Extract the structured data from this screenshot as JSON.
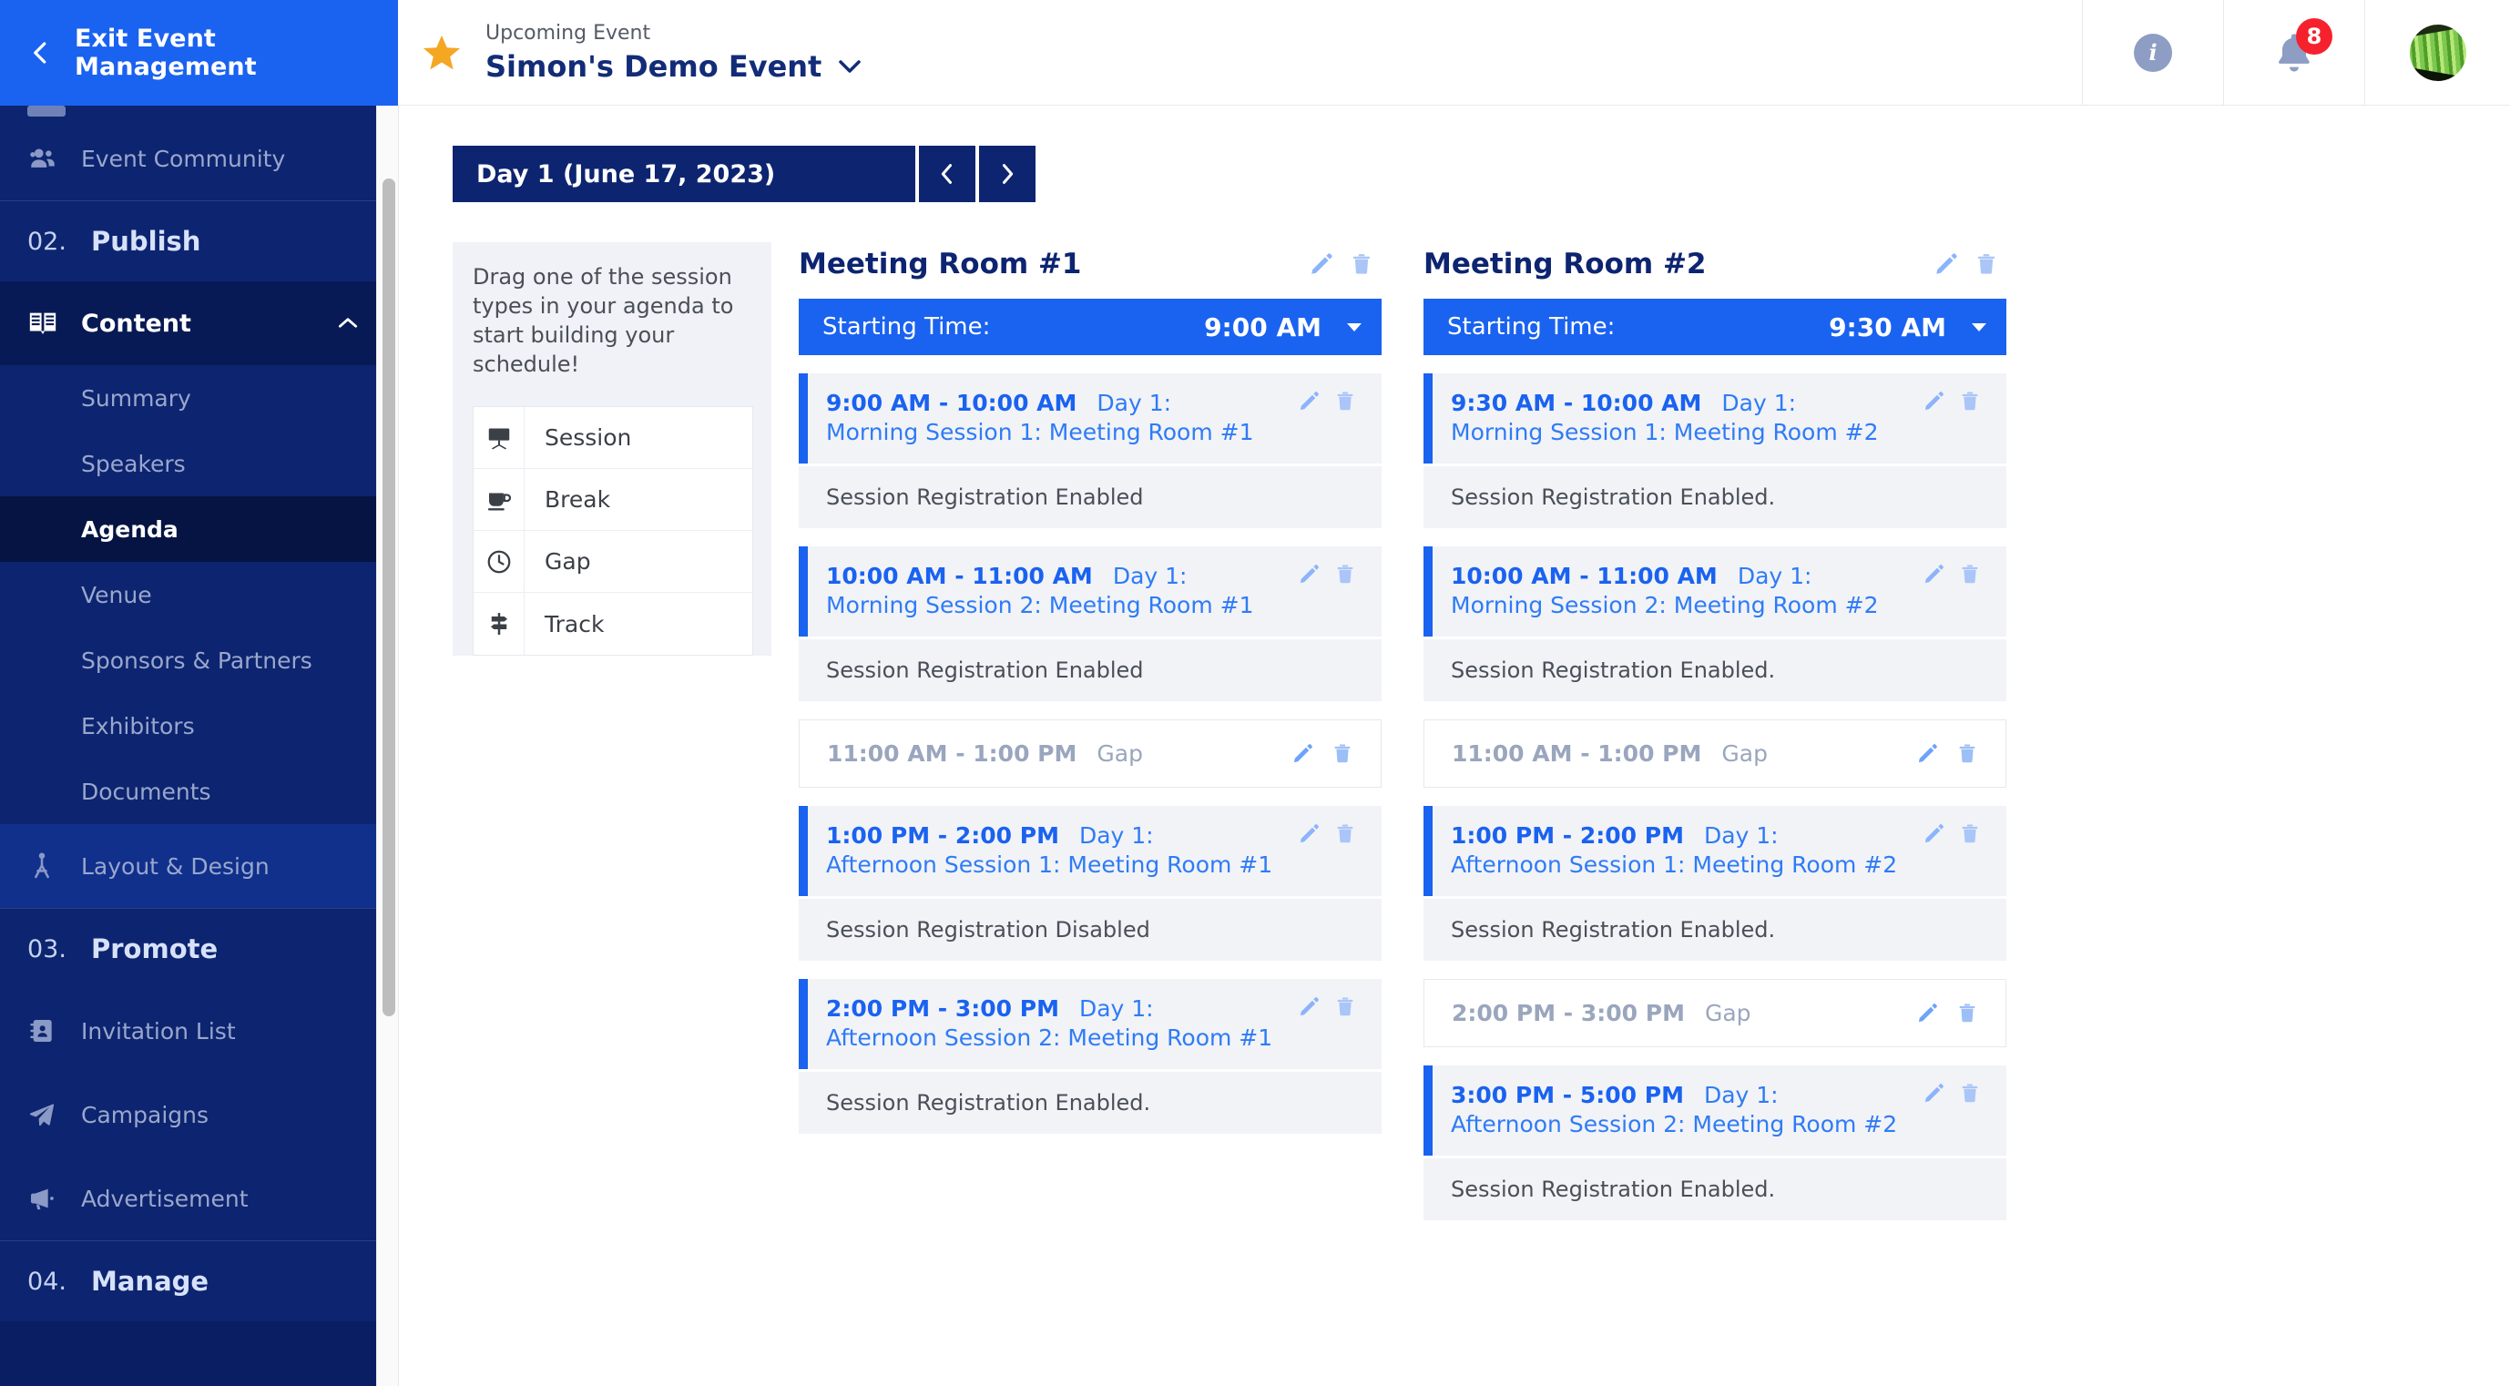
{
  "sidebar": {
    "exit_label": "Exit Event Management",
    "back_icon": "chevron-left-icon",
    "items": [
      {
        "label": "Event Community",
        "icon": "people-icon",
        "type": "item"
      }
    ],
    "groups": [
      {
        "number": "02.",
        "name": "Publish"
      },
      {
        "number": "03.",
        "name": "Promote"
      },
      {
        "number": "04.",
        "name": "Manage"
      }
    ],
    "content_section": {
      "label": "Content",
      "icon": "book-icon",
      "caret": "caret-up-icon",
      "children": [
        {
          "label": "Summary",
          "active": false
        },
        {
          "label": "Speakers",
          "active": false
        },
        {
          "label": "Agenda",
          "active": true
        },
        {
          "label": "Venue",
          "active": false
        },
        {
          "label": "Sponsors & Partners",
          "active": false
        },
        {
          "label": "Exhibitors",
          "active": false
        },
        {
          "label": "Documents",
          "active": false
        }
      ]
    },
    "layout_design": {
      "label": "Layout & Design",
      "icon": "design-icon"
    },
    "promote_items": [
      {
        "label": "Invitation List",
        "icon": "contact-book-icon"
      },
      {
        "label": "Campaigns",
        "icon": "paper-plane-icon"
      },
      {
        "label": "Advertisement",
        "icon": "megaphone-icon"
      }
    ]
  },
  "topbar": {
    "star_icon": "star-icon",
    "upcoming_label": "Upcoming Event",
    "event_name": "Simon's Demo Event",
    "event_caret_icon": "chevron-down-icon",
    "info_icon": "info-icon",
    "info_glyph": "i",
    "bell_icon": "bell-icon",
    "notification_count": "8",
    "avatar_icon": "user-avatar"
  },
  "daybar": {
    "day_label": "Day 1 (June 17, 2023)",
    "prev_icon": "chevron-left-icon",
    "next_icon": "chevron-right-icon"
  },
  "drag_panel": {
    "instruction": "Drag one of the session types in your agenda to start building your schedule!",
    "types": [
      {
        "label": "Session",
        "icon": "presentation-screen-icon"
      },
      {
        "label": "Break",
        "icon": "coffee-cup-icon"
      },
      {
        "label": "Gap",
        "icon": "clock-icon"
      },
      {
        "label": "Track",
        "icon": "signpost-icon"
      }
    ]
  },
  "colors": {
    "brand_blue": "#1a62f0",
    "navy": "#0d2470",
    "link_blue": "#2f7bf6",
    "muted": "#9aa6bd",
    "badge_red": "#f5222d",
    "star_gold": "#f5a623"
  },
  "rooms": [
    {
      "title": "Meeting Room #1",
      "edit_icon": "pencil-icon",
      "delete_icon": "trash-icon",
      "start_label": "Starting Time:",
      "start_value": "9:00 AM",
      "start_caret_icon": "caret-down-icon",
      "entries": [
        {
          "kind": "session",
          "time": "9:00 AM - 10:00 AM",
          "day": "Day 1:",
          "name": "Morning Session 1: Meeting Room #1",
          "note": "Session Registration Enabled",
          "edit_icon": "pencil-icon",
          "delete_icon": "trash-icon"
        },
        {
          "kind": "session",
          "time": "10:00 AM - 11:00 AM",
          "day": "Day 1:",
          "name": "Morning Session 2: Meeting Room #1",
          "note": "Session Registration Enabled",
          "edit_icon": "pencil-icon",
          "delete_icon": "trash-icon"
        },
        {
          "kind": "gap",
          "time": "11:00 AM - 1:00 PM",
          "label": "Gap",
          "edit_icon": "pencil-icon",
          "delete_icon": "trash-icon"
        },
        {
          "kind": "session",
          "time": "1:00 PM - 2:00 PM",
          "day": "Day 1:",
          "name": "Afternoon Session 1: Meeting Room #1",
          "note": "Session Registration Disabled",
          "edit_icon": "pencil-icon",
          "delete_icon": "trash-icon"
        },
        {
          "kind": "session",
          "time": "2:00 PM - 3:00 PM",
          "day": "Day 1:",
          "name": "Afternoon Session 2: Meeting Room #1",
          "note": "Session Registration Enabled.",
          "edit_icon": "pencil-icon",
          "delete_icon": "trash-icon"
        }
      ]
    },
    {
      "title": "Meeting Room #2",
      "edit_icon": "pencil-icon",
      "delete_icon": "trash-icon",
      "start_label": "Starting Time:",
      "start_value": "9:30 AM",
      "start_caret_icon": "caret-down-icon",
      "entries": [
        {
          "kind": "session",
          "time": "9:30 AM - 10:00 AM",
          "day": "Day 1:",
          "name": "Morning Session 1: Meeting Room #2",
          "note": "Session Registration Enabled.",
          "edit_icon": "pencil-icon",
          "delete_icon": "trash-icon"
        },
        {
          "kind": "session",
          "time": "10:00 AM - 11:00 AM",
          "day": "Day 1:",
          "name": "Morning Session 2: Meeting Room #2",
          "note": "Session Registration Enabled.",
          "edit_icon": "pencil-icon",
          "delete_icon": "trash-icon"
        },
        {
          "kind": "gap",
          "time": "11:00 AM - 1:00 PM",
          "label": "Gap",
          "edit_icon": "pencil-icon",
          "delete_icon": "trash-icon"
        },
        {
          "kind": "session",
          "time": "1:00 PM - 2:00 PM",
          "day": "Day 1:",
          "name": "Afternoon Session 1: Meeting Room #2",
          "note": "Session Registration Enabled.",
          "edit_icon": "pencil-icon",
          "delete_icon": "trash-icon"
        },
        {
          "kind": "gap",
          "time": "2:00 PM - 3:00 PM",
          "label": "Gap",
          "edit_icon": "pencil-icon",
          "delete_icon": "trash-icon"
        },
        {
          "kind": "session",
          "time": "3:00 PM - 5:00 PM",
          "day": "Day 1:",
          "name": "Afternoon Session 2: Meeting Room #2",
          "note": "Session Registration Enabled.",
          "edit_icon": "pencil-icon",
          "delete_icon": "trash-icon"
        }
      ]
    }
  ]
}
